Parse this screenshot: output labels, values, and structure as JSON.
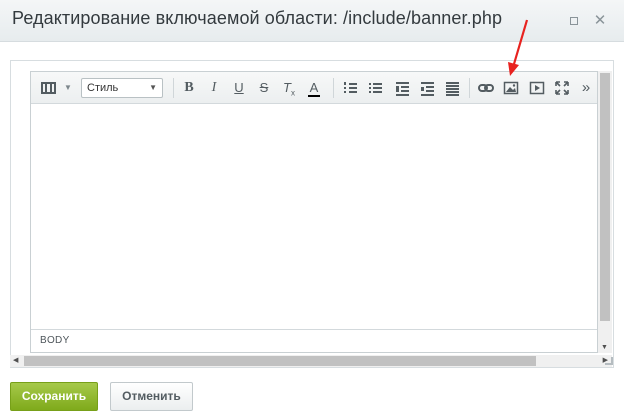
{
  "dialog": {
    "title": "Редактирование включаемой области: /include/banner.php",
    "expand_icon": "expand-icon",
    "close_icon": "close-icon",
    "close_glyph": "✕"
  },
  "toolbar": {
    "mode_icon": "film-icon",
    "style_select": {
      "value": "Стиль"
    },
    "bold_label": "B",
    "italic_label": "I",
    "underline_label": "U",
    "strike_label": "S",
    "clear_label": "T",
    "clear_sub": "x",
    "color_label": "A",
    "more_label": "»",
    "icons": [
      "bold-icon",
      "italic-icon",
      "underline-icon",
      "strikethrough-icon",
      "remove-format-icon",
      "font-color-icon",
      "ordered-list-icon",
      "unordered-list-icon",
      "indent-icon",
      "outdent-icon",
      "align-icon",
      "link-icon",
      "image-icon",
      "video-icon",
      "fullscreen-icon",
      "more-icon"
    ]
  },
  "editor": {
    "status_path": "BODY"
  },
  "buttons": {
    "save_label": "Сохранить",
    "cancel_label": "Отменить"
  },
  "colors": {
    "save_green": "#84ac1f",
    "annotation_red": "#e8221f"
  }
}
